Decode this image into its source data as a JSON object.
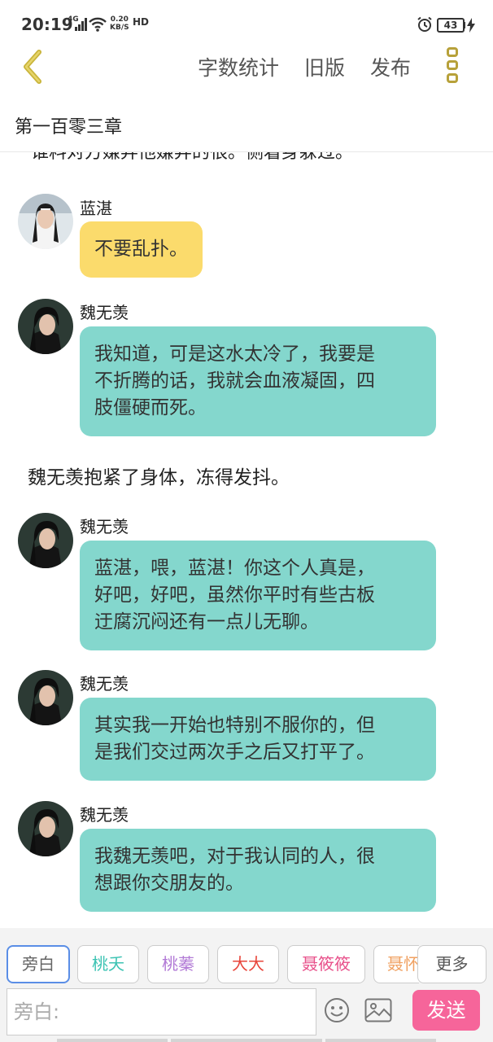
{
  "status_bar": {
    "time": "20:19",
    "network": "4G",
    "speed_value": "0.20",
    "speed_unit": "KB/S",
    "hd": "HD",
    "battery": "43"
  },
  "top_bar": {
    "word_count_label": "字数统计",
    "old_version_label": "旧版",
    "publish_label": "发布"
  },
  "chapter_title": "第一百零三章",
  "chat": {
    "clipped_line": "谁料对方嫌弃他嫌弃的很。侧着身躲过。",
    "messages": [
      {
        "speaker": "蓝湛",
        "lines": [
          "不要乱扑。"
        ]
      },
      {
        "speaker": "魏无羡",
        "lines": [
          "我知道，可是这水太冷了，我要是",
          "不折腾的话，我就会血液凝固，四",
          "肢僵硬而死。"
        ]
      },
      {
        "narration": "魏无羡抱紧了身体，冻得发抖。"
      },
      {
        "speaker": "魏无羡",
        "lines": [
          "蓝湛，喂，蓝湛！你这个人真是，",
          "好吧，好吧，虽然你平时有些古板",
          "迂腐沉闷还有一点儿无聊。"
        ]
      },
      {
        "speaker": "魏无羡",
        "lines": [
          "其实我一开始也特别不服你的，但",
          "是我们交过两次手之后又打平了。"
        ]
      },
      {
        "speaker": "魏无羡",
        "lines": [
          "我魏无羡吧，对于我认同的人，很",
          "想跟你交朋友的。"
        ]
      }
    ]
  },
  "roles": [
    {
      "label": "旁白",
      "color": "#666666"
    },
    {
      "label": "桃夭",
      "color": "#3cc3b3"
    },
    {
      "label": "桃蓁",
      "color": "#b27ad6"
    },
    {
      "label": "大大",
      "color": "#e8443a"
    },
    {
      "label": "聂筱筱",
      "color": "#e8508a"
    },
    {
      "label": "聂怀",
      "color": "#f0a060"
    }
  ],
  "more_label": "更多",
  "input": {
    "placeholder": "旁白:"
  },
  "send_label": "发送",
  "colors": {
    "teal_bubble": "#84d7cd",
    "yellow_bubble": "#fbdb6c",
    "send_button": "#f6659a",
    "back_arrow": "#c9b43a"
  },
  "icons": [
    "back-arrow-icon",
    "more-vertical-icon",
    "emoji-icon",
    "image-icon",
    "alarm-icon",
    "battery-icon",
    "wifi-icon",
    "signal-icon"
  ]
}
